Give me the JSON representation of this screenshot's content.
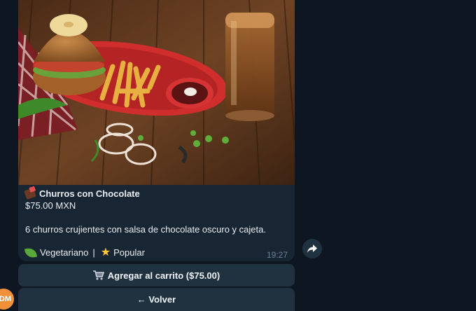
{
  "avatar": {
    "initials": "DM",
    "color": "#f0913a"
  },
  "message": {
    "icon": "chocolate-bar-icon",
    "title": "Churros con Chocolate",
    "price": "$75.00 MXN",
    "description": "6 churros crujientes con salsa de chocolate oscuro y cajeta.",
    "tags": [
      {
        "icon": "leaf-icon",
        "label": "Vegetariano"
      },
      {
        "icon": "star-icon",
        "label": "Popular"
      }
    ],
    "tag_separator": "|",
    "time": "19:27"
  },
  "keyboard": {
    "add_to_cart": {
      "icon": "shopping-cart-icon",
      "label": "Agregar al carrito ($75.00)"
    },
    "back": {
      "label": "← Volver"
    }
  },
  "share_button": {
    "icon": "share-icon"
  },
  "colors": {
    "background": "#0e1621",
    "bubble": "#182533",
    "button": "#203140",
    "time": "#6d8295"
  }
}
